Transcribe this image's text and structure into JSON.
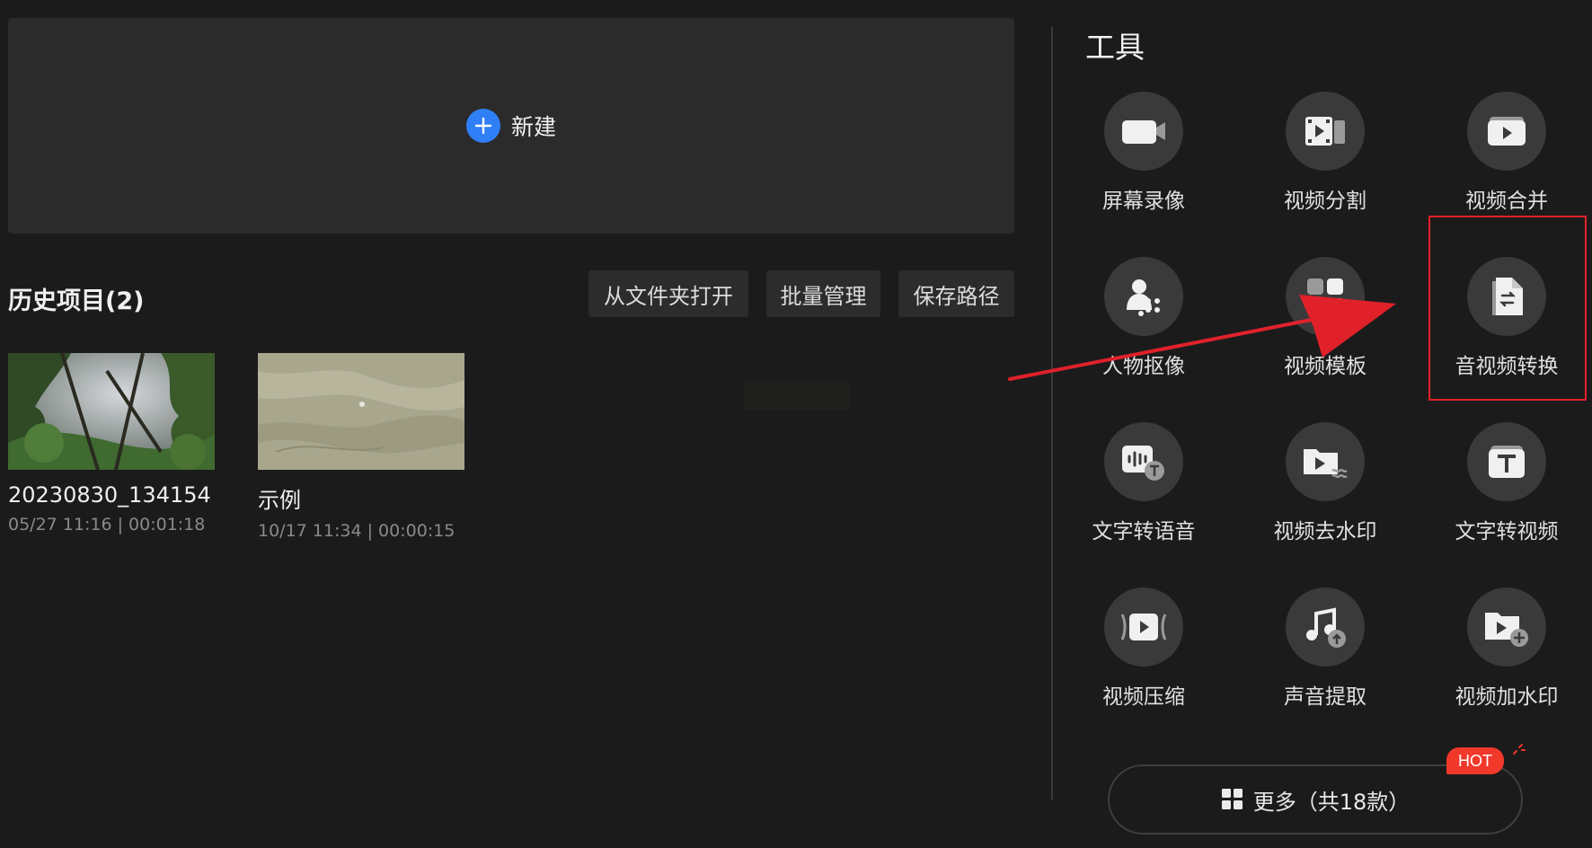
{
  "new_project": {
    "label": "新建"
  },
  "history": {
    "title": "历史项目(2)",
    "buttons": [
      "从文件夹打开",
      "批量管理",
      "保存路径"
    ],
    "projects": [
      {
        "name": "20230830_134154",
        "meta": "05/27 11:16 | 00:01:18",
        "thumbnail": "forest-canopy"
      },
      {
        "name": "示例",
        "meta": "10/17 11:34 | 00:00:15",
        "thumbnail": "sand-dunes"
      }
    ]
  },
  "tools": {
    "title": "工具",
    "items": [
      {
        "label": "屏幕录像",
        "icon": "camera-icon"
      },
      {
        "label": "视频分割",
        "icon": "film-split-icon"
      },
      {
        "label": "视频合并",
        "icon": "video-merge-icon"
      },
      {
        "label": "人物抠像",
        "icon": "person-cutout-icon"
      },
      {
        "label": "视频模板",
        "icon": "template-icon"
      },
      {
        "label": "音视频转换",
        "icon": "file-convert-icon"
      },
      {
        "label": "文字转语音",
        "icon": "text-to-speech-icon"
      },
      {
        "label": "视频去水印",
        "icon": "remove-watermark-icon"
      },
      {
        "label": "文字转视频",
        "icon": "text-to-video-icon"
      },
      {
        "label": "视频压缩",
        "icon": "video-compress-icon"
      },
      {
        "label": "声音提取",
        "icon": "audio-extract-icon"
      },
      {
        "label": "视频加水印",
        "icon": "add-watermark-icon"
      }
    ],
    "more": {
      "label": "更多（共18款）",
      "badge": "HOT"
    }
  },
  "colors": {
    "accent": "#2f7ff6",
    "annotation": "#e0212a",
    "hot": "#f0382b"
  }
}
